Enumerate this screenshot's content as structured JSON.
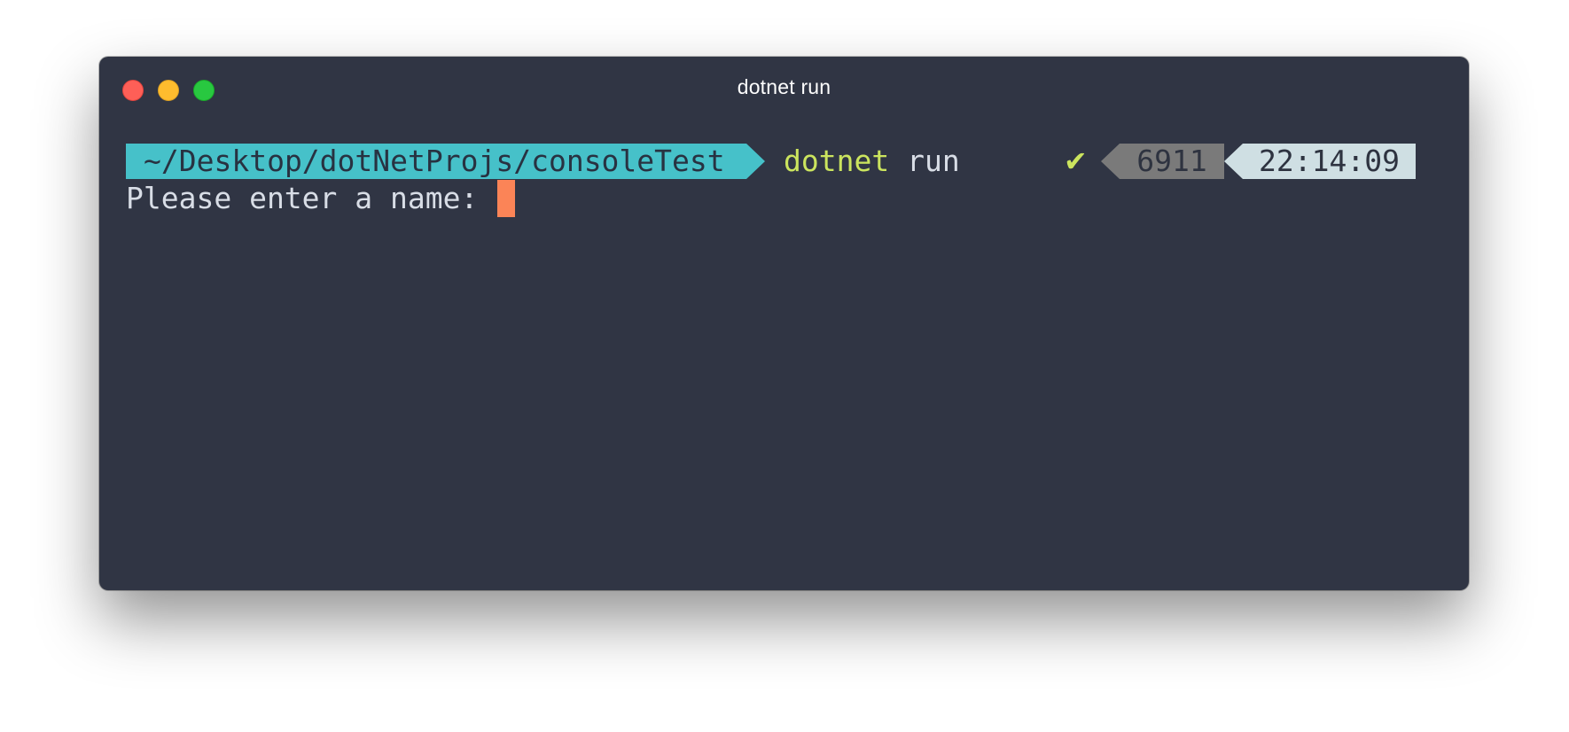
{
  "window": {
    "title": "dotnet run",
    "controls": [
      "close",
      "minimize",
      "maximize"
    ]
  },
  "prompt": {
    "path": "~/Desktop/dotNetProjs/consoleTest",
    "command": "dotnet",
    "argument": "run",
    "status_icon": "check-icon",
    "status_glyph": "✔",
    "pid": "6911",
    "time": "22:14:09"
  },
  "output": {
    "line": "Please enter a name: "
  },
  "colors": {
    "background": "#303544",
    "path_segment": "#46c1c9",
    "command": "#cbe45e",
    "pid_segment": "#7a7a7a",
    "time_segment": "#cfdfe3",
    "cursor": "#fb8457"
  }
}
